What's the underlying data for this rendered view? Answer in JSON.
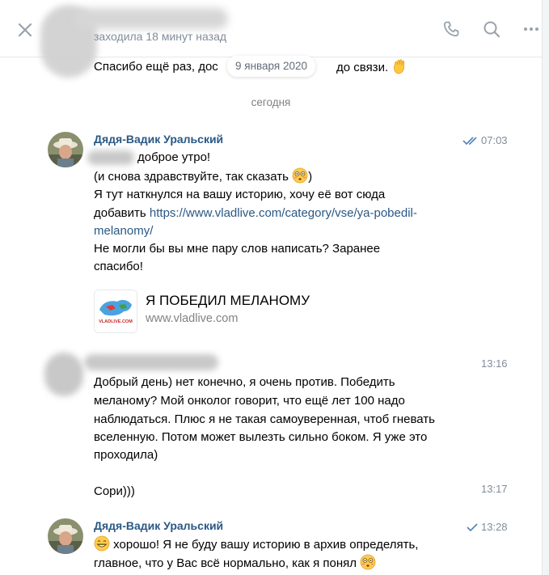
{
  "header": {
    "status": "заходила 18 минут назад"
  },
  "date_divider": "9 января 2020",
  "prev_message_left": "Спасибо ещё раз, дос",
  "prev_message_right": "до связи.",
  "today_label": "сегодня",
  "msg1": {
    "sender": "Дядя-Вадик Уральский",
    "time": "07:03",
    "line1": "доброе утро!",
    "line2": "(и снова здравствуйте, так сказать",
    "line2_end": ")",
    "line3": "Я тут наткнулся на вашу историю, хочу её вот сюда",
    "line4_prefix": "добавить ",
    "link_part1": "https://www.vladlive.com/category/vse/ya-pobedil-",
    "link_part2": "melanomy/",
    "line5": "Не могли бы вы мне пару слов написать?  Заранее",
    "line6": "спасибо!",
    "snippet_title": "Я ПОБЕДИЛ МЕЛАНОМУ",
    "snippet_domain": "www.vladlive.com",
    "snippet_logo_text": "VLADLIVE.COM"
  },
  "msg2": {
    "time1": "13:16",
    "line1": "Добрый день) нет конечно, я очень против. Победить",
    "line2": "меланому? Мой онколог говорит, что ещё лет 100 надо",
    "line3": "наблюдаться. Плюс я не такая самоуверенная, чтоб гневать",
    "line4": "вселенную. Потом может вылезть сильно боком. Я уже это",
    "line5": "проходила)",
    "time2": "13:17",
    "line6": "Сори)))"
  },
  "msg3": {
    "sender": "Дядя-Вадик Уральский",
    "time": "13:28",
    "line1": "хорошо! Я не буду вашу историю в архив определять,",
    "line2": "главное, что у Вас всё нормально, как я понял"
  },
  "colors": {
    "link": "#2a5885",
    "muted": "#818c99",
    "check": "#5181b8"
  },
  "icons": [
    "close-icon",
    "phone-icon",
    "search-icon",
    "more-icon",
    "double-check-icon",
    "check-icon",
    "wave-emoji",
    "flushed-emoji",
    "grin-emoji"
  ]
}
